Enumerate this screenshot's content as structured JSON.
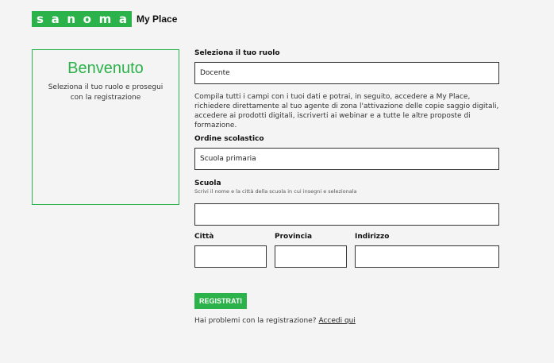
{
  "header": {
    "logo_letters": [
      "s",
      "a",
      "n",
      "o",
      "m",
      "a"
    ],
    "logo_suffix": "My Place",
    "brand_color": "#2cb24a"
  },
  "welcome": {
    "title": "Benvenuto",
    "subtitle": "Seleziona il tuo ruolo e prosegui con la registrazione"
  },
  "form": {
    "role": {
      "label": "Seleziona il tuo ruolo",
      "value": "Docente"
    },
    "info_text": "Compila tutti i campi con i tuoi dati e potrai, in seguito, accedere a My Place, richiedere direttamente al tuo agente di zona l'attivazione delle copie saggio digitali, accedere ai prodotti digitali, iscriverti ai webinar e a tutte le altre proposte di formazione.",
    "order": {
      "label": "Ordine scolastico",
      "value": "Scuola primaria"
    },
    "school": {
      "label": "Scuola",
      "hint": "Scrivi il nome e la città della scuola in cui insegni e selezionala",
      "value": ""
    },
    "city": {
      "label": "Città",
      "value": ""
    },
    "province": {
      "label": "Provincia",
      "value": ""
    },
    "address": {
      "label": "Indirizzo",
      "value": ""
    },
    "submit_label": "REGISTRATI",
    "help_text": "Hai problemi con la registrazione?",
    "help_link": "Accedi qui"
  }
}
